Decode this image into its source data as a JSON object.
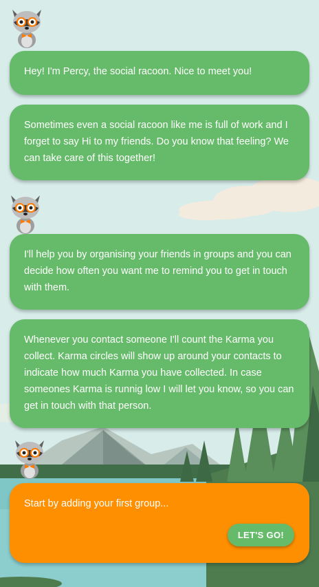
{
  "messages": [
    {
      "text": "Hey! I'm Percy, the social racoon. Nice to meet you!"
    },
    {
      "text": "Sometimes even a social racoon like me is full of work and I forget to say Hi to my friends. Do you know that feeling? We can take care of this together!"
    },
    {
      "text": "I'll help you by organising your friends in groups and you can decide how often you want me to remind you to get in touch with them."
    },
    {
      "text": "Whenever you contact someone I'll count the Karma you collect. Karma circles will show up around your contacts to indicate how much Karma you have collected. In case someones Karma is runnig low I will let you know, so you can get in touch with that person."
    },
    {
      "text": "Start by adding your first group..."
    }
  ],
  "cta": {
    "label": "LET'S GO!"
  },
  "colors": {
    "bubble_green": "#66bb6a",
    "bubble_orange": "#fe8f00",
    "sky": "#d8ecea",
    "lake": "#7fc6c6"
  },
  "icons": {
    "avatar": "raccoon-mascot-icon"
  }
}
